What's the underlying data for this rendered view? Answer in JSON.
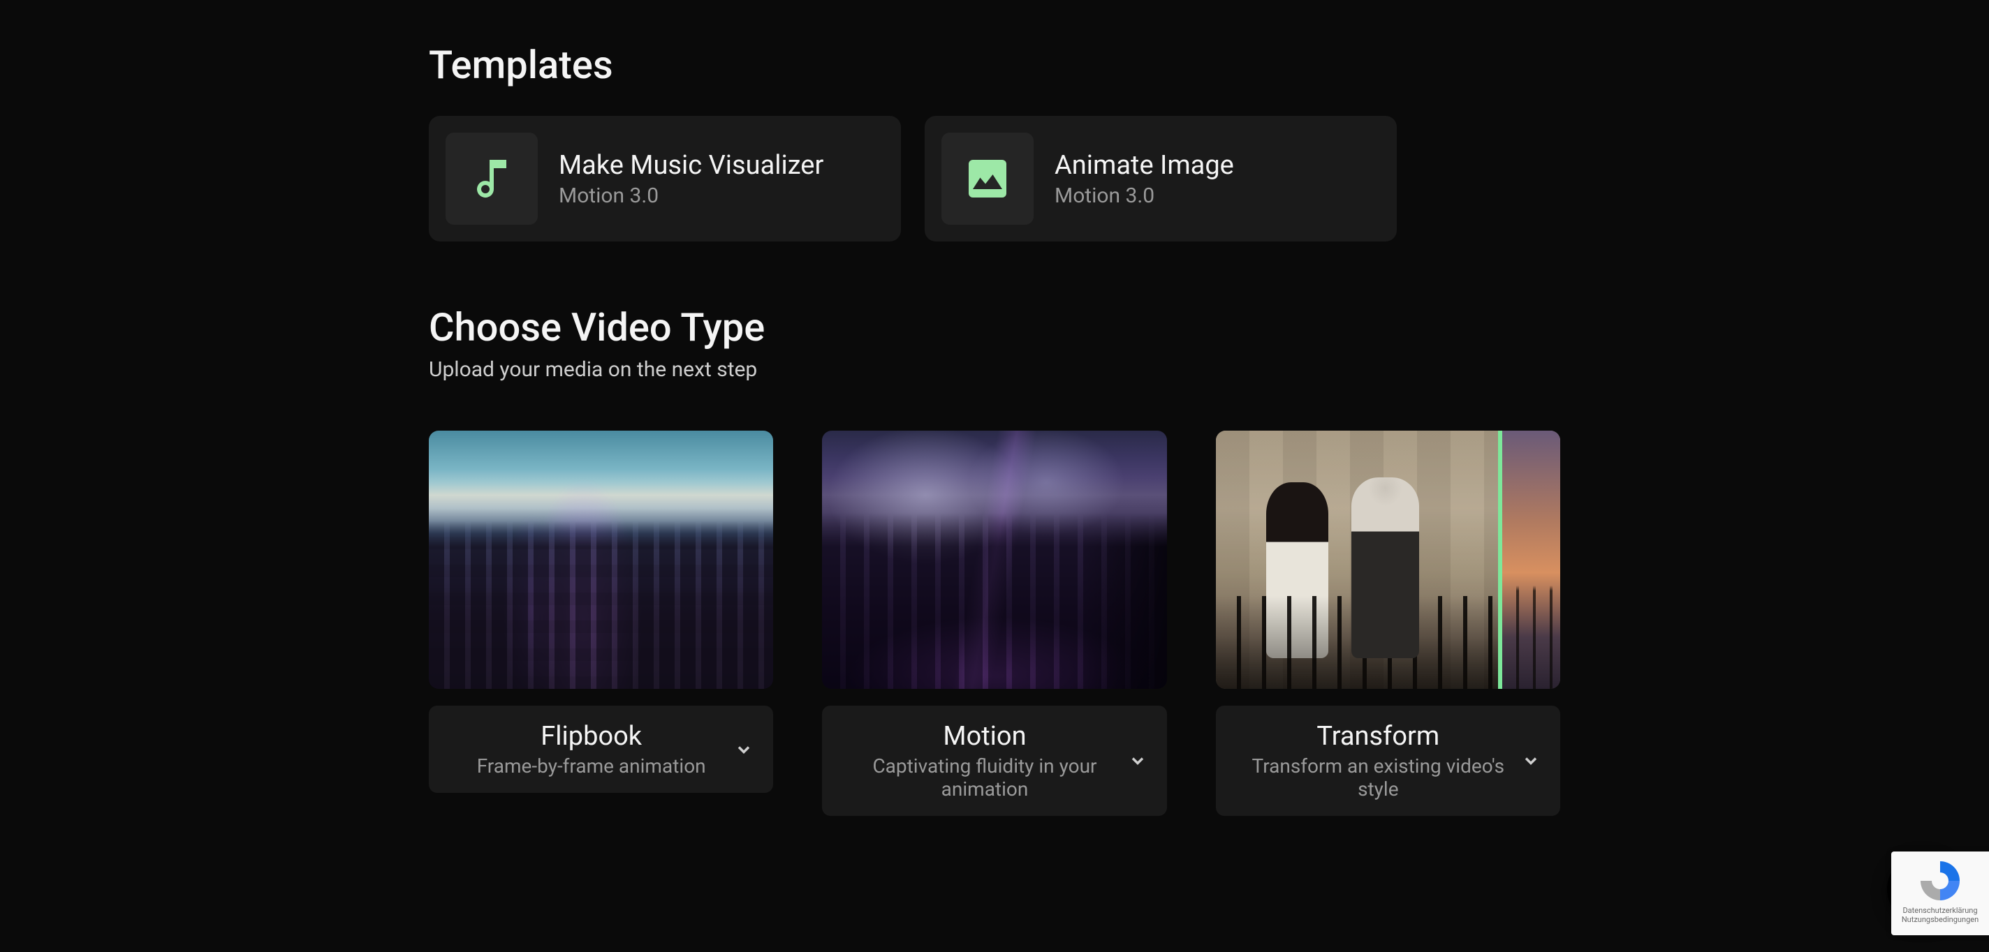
{
  "templates": {
    "heading": "Templates",
    "items": [
      {
        "icon": "music-icon",
        "title": "Make Music Visualizer",
        "subtitle": "Motion 3.0"
      },
      {
        "icon": "image-icon",
        "title": "Animate Image",
        "subtitle": "Motion 3.0"
      }
    ]
  },
  "chooseVideo": {
    "heading": "Choose Video Type",
    "subheading": "Upload your media on the next step",
    "types": [
      {
        "title": "Flipbook",
        "subtitle": "Frame-by-frame animation"
      },
      {
        "title": "Motion",
        "subtitle": "Captivating fluidity in your animation"
      },
      {
        "title": "Transform",
        "subtitle": "Transform an existing video's style"
      }
    ]
  },
  "recaptcha": {
    "line1": "Datenschutzerklärung",
    "line2": "Nutzungsbedingungen"
  }
}
